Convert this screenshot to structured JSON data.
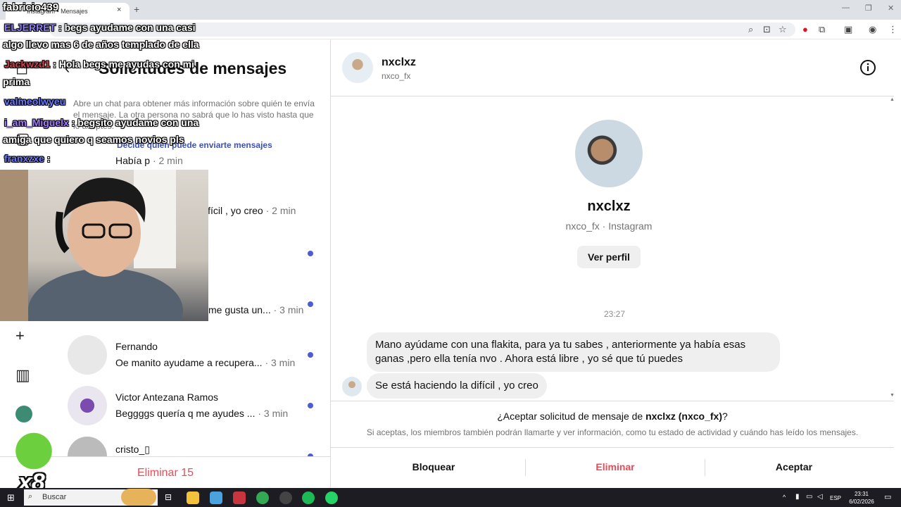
{
  "browser": {
    "tab_title": "Instagram • Mensajes",
    "tab_close": "×",
    "new_tab": "+",
    "window_controls": [
      "—",
      "❐",
      "✕"
    ]
  },
  "left": {
    "title": "Solicitudes de mensajes",
    "info_text": "Abre un chat para obtener más información sobre quién te envía el mensaje. La otra persona no sabrá que lo has visto hasta que lo aceptes.",
    "who_link": "Decide quién puede enviarte mensajes",
    "requests": [
      {
        "name": "",
        "message": "Había p",
        "time": "· 2 min",
        "unread": false
      },
      {
        "name": "",
        "message": "ifícil , yo creo",
        "time": "· 2 min",
        "unread": false
      },
      {
        "name": "",
        "message": "",
        "time": "",
        "unread": true
      },
      {
        "name": "",
        "message": "me gusta un...",
        "time": "· 3 min",
        "unread": true
      },
      {
        "name": "Fernando",
        "message": "Oe manito ayudame a recupera...",
        "time": "· 3 min",
        "unread": true
      },
      {
        "name": "Victor Antezana Ramos",
        "message": "Beggggs quería q me ayudes ...",
        "time": "· 3 min",
        "unread": true
      },
      {
        "name": "cristo_▯",
        "message": "",
        "time": "",
        "unread": true
      }
    ],
    "delete_all": "Eliminar 15"
  },
  "conversation": {
    "header_name": "nxclxz",
    "header_user": "nxco_fx",
    "profile_name": "nxclxz",
    "profile_sub": "nxco_fx · Instagram",
    "view_profile": "Ver perfil",
    "time_separator": "23:27",
    "messages": [
      "Mano ayúdame con una flakita, para ya tu sabes , anteriormente ya había esas ganas ,pero ella tenía nvo . Ahora está libre , yo sé que tú puedes",
      "Se está haciendo la difícil , yo creo"
    ],
    "accept_question_prefix": "¿Aceptar solicitud de mensaje de ",
    "accept_question_user": "nxclxz (nxco_fx)",
    "accept_question_suffix": "?",
    "accept_note": "Si aceptas, los miembros también podrán llamarte y ver información, como tu estado de actividad y cuándo has leído los mensajes.",
    "actions": {
      "block": "Bloquear",
      "delete": "Eliminar",
      "accept": "Aceptar"
    }
  },
  "stream_overlay": {
    "top_user": "fabricio439",
    "chat": [
      {
        "user": "ELJERRET",
        "text": ": begs ayudame con una casi"
      },
      {
        "user": "",
        "text": "algo llevo mas 6 de años templado de ella"
      },
      {
        "user": "Jackwzd1",
        "text": ": Hola begs me ayudas con mi"
      },
      {
        "user": "",
        "text": "prima"
      },
      {
        "user": "valmeolwyeu",
        "text": ""
      },
      {
        "user": "i_am_Miguelx",
        "text": ": begsito ayudame con una"
      },
      {
        "user": "",
        "text": "amiga que quiero q seamos novios pls"
      },
      {
        "user": "franxzxe",
        "text": ":"
      }
    ],
    "sub_counter": "x8"
  },
  "taskbar": {
    "search_placeholder": "Buscar",
    "language": "ESP",
    "time": "23:31",
    "date": "6/02/2026"
  },
  "colors": {
    "accent_blue": "#4f5bd5",
    "danger_red": "#ed4956",
    "link": "#3f51b5",
    "muted": "#737373"
  }
}
